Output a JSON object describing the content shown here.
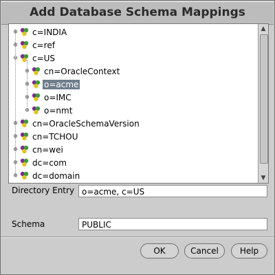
{
  "dialog": {
    "title": "Add Database Schema Mappings"
  },
  "tree": {
    "nodes": [
      {
        "label": "c=INDIA",
        "level": 0,
        "expanded": false,
        "selected": false
      },
      {
        "label": "c=ref",
        "level": 0,
        "expanded": false,
        "selected": false
      },
      {
        "label": "c=US",
        "level": 0,
        "expanded": true,
        "selected": false
      },
      {
        "label": "cn=OracleContext",
        "level": 1,
        "expanded": false,
        "selected": false
      },
      {
        "label": "o=acme",
        "level": 1,
        "expanded": false,
        "selected": true
      },
      {
        "label": "o=IMC",
        "level": 1,
        "expanded": false,
        "selected": false
      },
      {
        "label": "o=nmt",
        "level": 1,
        "expanded": false,
        "selected": false
      },
      {
        "label": "cn=OracleSchemaVersion",
        "level": 0,
        "expanded": false,
        "selected": false
      },
      {
        "label": "cn=TCHOU",
        "level": 0,
        "expanded": false,
        "selected": false
      },
      {
        "label": "cn=wei",
        "level": 0,
        "expanded": false,
        "selected": false
      },
      {
        "label": "dc=com",
        "level": 0,
        "expanded": false,
        "selected": false
      },
      {
        "label": "dc=domain",
        "level": 0,
        "expanded": false,
        "selected": false
      }
    ],
    "toggle_collapsed": "⊕",
    "toggle_expanded": "⊖",
    "icon": "ldap-entry-icon"
  },
  "form": {
    "directory_entry_label": "Directory Entry",
    "directory_entry_value": "o=acme, c=US",
    "schema_label": "Schema",
    "schema_value": "PUBLIC"
  },
  "buttons": {
    "ok": "OK",
    "cancel": "Cancel",
    "help": "Help"
  },
  "scrollbar": {
    "up": "▲",
    "down": "▼"
  }
}
